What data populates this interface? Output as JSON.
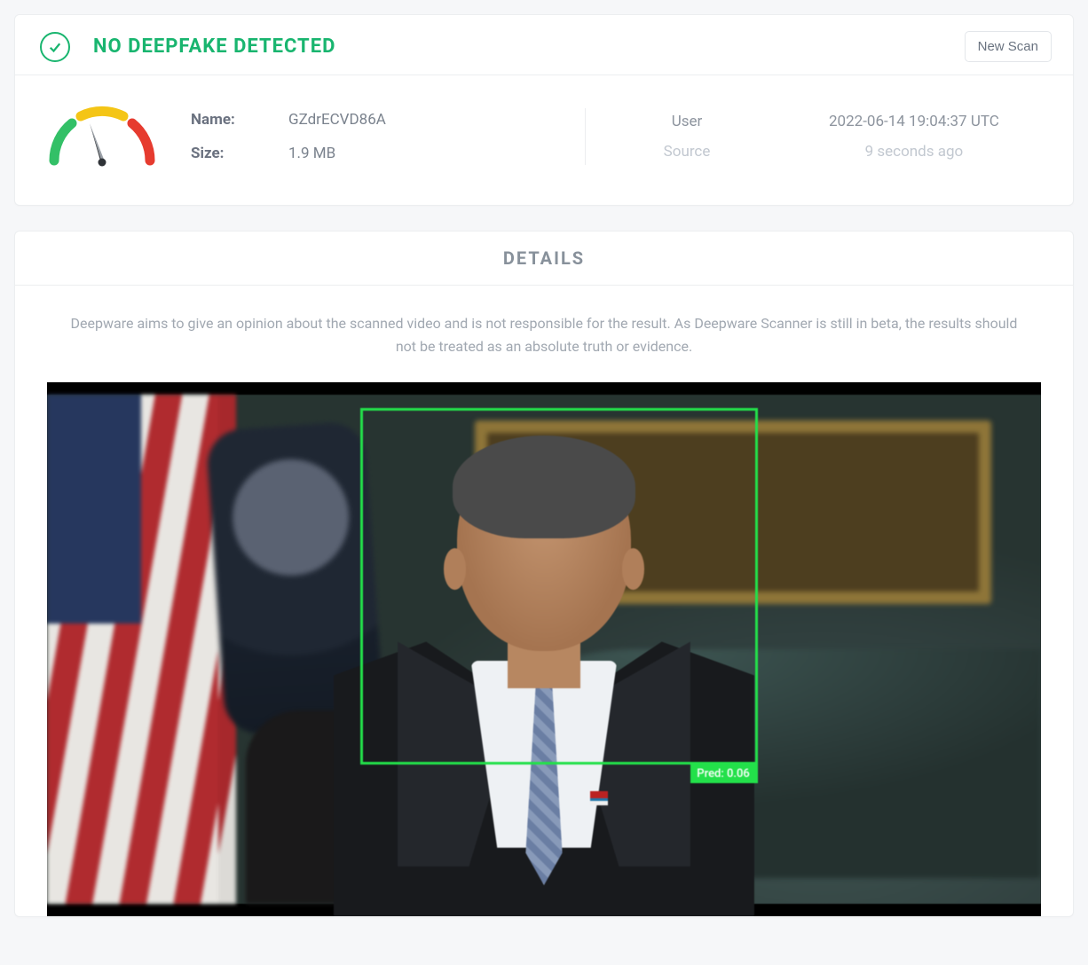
{
  "result": {
    "title": "NO DEEPFAKE DETECTED",
    "status_icon": "check-circle-icon",
    "new_scan_label": "New Scan",
    "name_label": "Name:",
    "name_value": "GZdrECVD86A",
    "size_label": "Size:",
    "size_value": "1.9 MB",
    "meta_type": "User",
    "meta_source": "Source",
    "timestamp": "2022-06-14 19:04:37 UTC",
    "relative_time": "9 seconds ago",
    "gauge_level": "low"
  },
  "details": {
    "header": "DETAILS",
    "disclaimer": "Deepware aims to give an opinion about the scanned video and is not responsible for the result. As Deepware Scanner is still in beta, the results should not be treated as an absolute truth or evidence.",
    "prediction_label": "Pred: 0.06",
    "prediction_value": 0.06
  },
  "colors": {
    "accent_green": "#19b56f",
    "detect_green": "#23e04a"
  }
}
